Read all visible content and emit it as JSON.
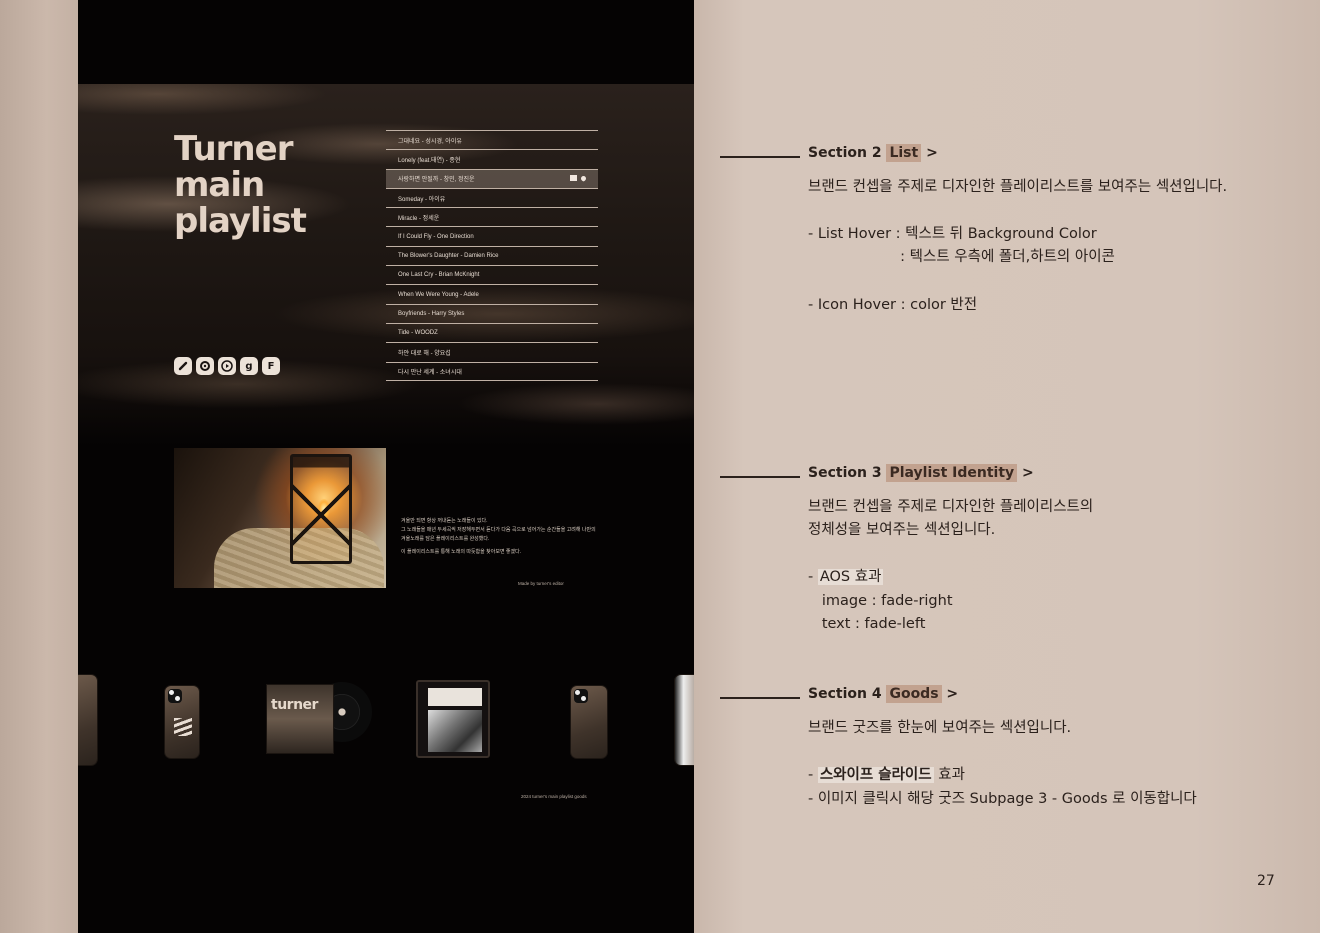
{
  "hero": {
    "title_lines": [
      "Turner",
      "main",
      "playlist"
    ],
    "tracks": [
      "그대네요 - 성시경, 아이유",
      "Lonely (feat.태연) - 종현",
      "사랑하면 안될까 - 창민, 정진운",
      "Someday - 아이유",
      "Miracle - 정세운",
      "If I Could Fly - One Direction",
      "The Blower's Daughter - Damien Rice",
      "One Last Cry - Brian McKnight",
      "When We Were Young - Adele",
      "Boyfriends - Harry Styles",
      "Tide - WOODZ",
      "하얀 대로 해 - 양요섭",
      "다시 만난 세계 - 소녀시대"
    ],
    "hovered_track_index": 2,
    "socials": [
      "link-icon",
      "music-icon",
      "play-icon",
      "g",
      "F"
    ]
  },
  "identity": {
    "paragraph1": "겨울만 되면 항상 꺼내듣는 노래들이 있다.",
    "paragraph2": "그 노래들을 매년 두세곡씩 저장해두면서 듣다가 다음 곡으로 넘어가는 순간들을 고려해 나만의 겨울노래를 담은 플레이리스트를 완성했다.",
    "paragraph3": "이 플레이리스트를 통해 노래의 따듯함을 찾아보면 좋겠다.",
    "credit": "Made by turner's editor"
  },
  "goods": {
    "album_logo": "turner",
    "caption": "2024 turner's main playlist goods"
  },
  "sections": [
    {
      "label": "Section 2",
      "name": "List",
      "arrow": ">",
      "desc": "브랜드 컨셉을 주제로 디자인한 플레이리스트를 보여주는 섹션입니다.",
      "bullets": [
        "- List Hover : 텍스트 뒤 Background Color",
        "                    : 텍스트 우측에 폴더,하트의 아이콘",
        "",
        "- Icon Hover : color 반전"
      ]
    },
    {
      "label": "Section 3",
      "name": "Playlist Identity",
      "arrow": ">",
      "desc_lines": [
        "브랜드 컨셉을 주제로 디자인한 플레이리스트의",
        "정체성을 보여주는 섹션입니다."
      ],
      "aos_prefix": "- ",
      "aos_label": "AOS 효과",
      "aos_lines": [
        "   image : fade-right",
        "   text : fade-left"
      ]
    },
    {
      "label": "Section 4",
      "name": "Goods",
      "arrow": ">",
      "desc": "브랜드 굿즈를 한눈에 보여주는 섹션입니다.",
      "swipe_prefix": "- ",
      "swipe_label": "스와이프 슬라이드",
      "swipe_suffix": " 효과",
      "click_line": "- 이미지 클릭시 해당 굿즈 Subpage 3 - Goods 로 이동합니다"
    }
  ],
  "page_number": "27",
  "colors": {
    "page_bg": "#d4c3b8",
    "screen_bg": "#050303",
    "title_color": "#e3d3c5",
    "highlight": "#c2a28f",
    "text_dark": "#2b211c"
  }
}
